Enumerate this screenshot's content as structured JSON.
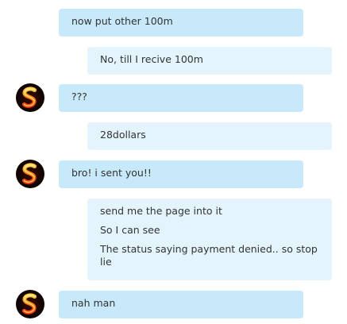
{
  "conversation": {
    "messages": [
      {
        "direction": "incoming",
        "show_avatar": false,
        "lines": [
          "now put other 100m"
        ]
      },
      {
        "direction": "outgoing",
        "lines": [
          "No, till I recive 100m"
        ]
      },
      {
        "direction": "incoming",
        "show_avatar": true,
        "lines": [
          "???"
        ]
      },
      {
        "direction": "outgoing",
        "lines": [
          "28dollars"
        ]
      },
      {
        "direction": "incoming",
        "show_avatar": true,
        "lines": [
          "bro! i sent you!!"
        ]
      },
      {
        "direction": "outgoing",
        "lines": [
          "send me the page into it",
          "So I can see",
          "The status saying payment denied.. so stop lie"
        ]
      },
      {
        "direction": "incoming",
        "show_avatar": true,
        "lines": [
          "nah man"
        ]
      }
    ]
  },
  "avatar": {
    "icon": "flaming-s-icon"
  },
  "colors": {
    "incoming_bubble": "#c7e9f9",
    "outgoing_bubble": "#e3f4fc",
    "text": "#333333"
  }
}
